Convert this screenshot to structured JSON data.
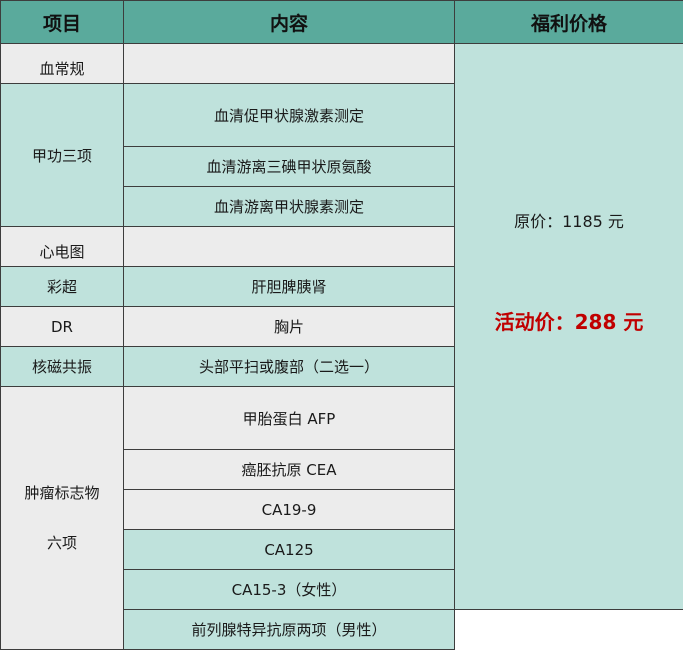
{
  "header": {
    "item": "项目",
    "content": "内容",
    "price": "福利价格"
  },
  "rows": {
    "blood_routine": {
      "item": "血常规",
      "content": ""
    },
    "thyroid": {
      "item": "甲功三项",
      "contents": [
        "血清促甲状腺激素测定",
        "血清游离三碘甲状原氨酸",
        "血清游离甲状腺素测定"
      ]
    },
    "ecg": {
      "item": "心电图",
      "content": ""
    },
    "ultrasound": {
      "item": "彩超",
      "content": "肝胆脾胰肾"
    },
    "dr": {
      "item": "DR",
      "content": "胸片"
    },
    "mri": {
      "item": "核磁共振",
      "content": "头部平扫或腹部（二选一）"
    },
    "tumor": {
      "item_line1": "肿瘤标志物",
      "item_line2": "六项",
      "contents": [
        "甲胎蛋白 AFP",
        "癌胚抗原 CEA",
        "CA19-9",
        "CA125",
        "CA15-3（女性）",
        "前列腺特异抗原两项（男性）"
      ]
    }
  },
  "price": {
    "original": "原价：1185 元",
    "promo": "活动价：288 元"
  },
  "colors": {
    "header_bg": "#5aaa9c",
    "teal_cell": "#bfe2dc",
    "gray_cell": "#ececec",
    "promo_text": "#c00000"
  }
}
